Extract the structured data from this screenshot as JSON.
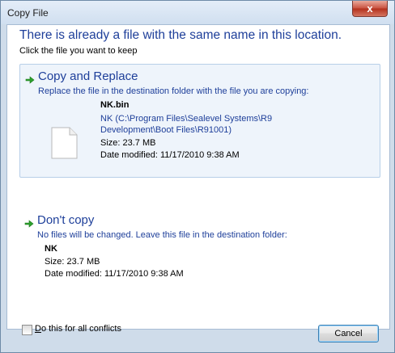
{
  "window": {
    "title": "Copy File",
    "close_label": "x"
  },
  "dialog": {
    "headline": "There is already a file with the same name in this location.",
    "subhead": "Click the file you want to keep"
  },
  "copy_replace": {
    "title": "Copy and Replace",
    "description": "Replace the file in the destination folder with the file you are copying:",
    "file": {
      "name": "NK.bin",
      "path_line1": "NK (C:\\Program Files\\Sealevel Systems\\R9",
      "path_line2": "Development\\Boot Files\\R91001)",
      "size": "Size: 23.7 MB",
      "modified": "Date modified: 11/17/2010 9:38 AM"
    }
  },
  "dont_copy": {
    "title": "Don't copy",
    "description": "No files will be changed. Leave this file in the destination folder:",
    "file": {
      "name": "NK",
      "size": "Size: 23.7 MB",
      "modified": "Date modified: 11/17/2010 9:38 AM"
    }
  },
  "footer": {
    "checkbox_label_accel": "D",
    "checkbox_label_rest": "o this for all conflicts",
    "checkbox_checked": false,
    "cancel_label": "Cancel"
  },
  "colors": {
    "heading_blue": "#1e3f9a",
    "arrow_green": "#2ea12e",
    "selected_bg": "#eef4fb",
    "close_red": "#c9513f"
  },
  "icons": {
    "arrow": "green-arrow-icon",
    "file": "document-file-icon",
    "close": "close-icon"
  }
}
